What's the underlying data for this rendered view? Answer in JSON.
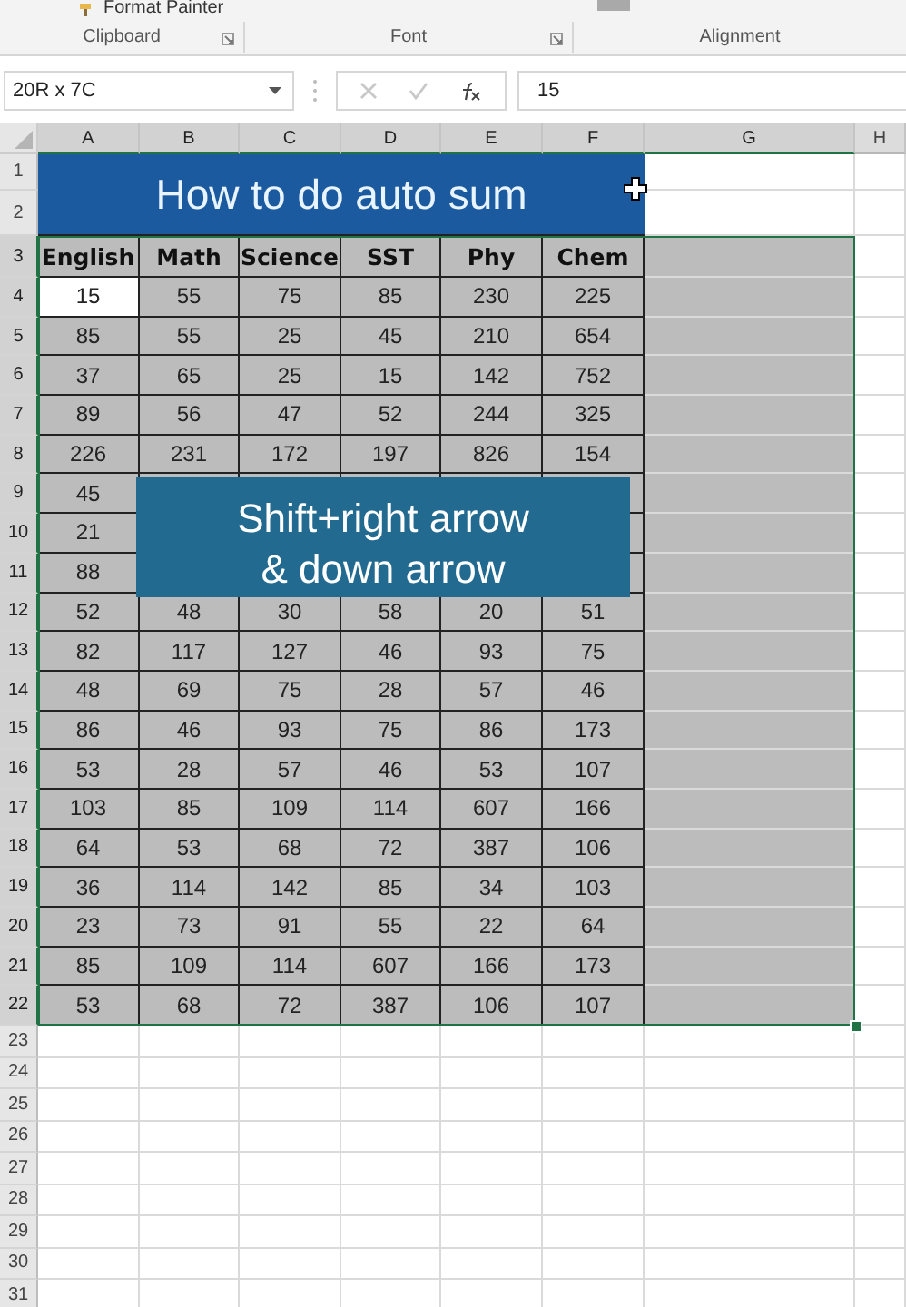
{
  "ribbon": {
    "items": [
      {
        "label": "Format Painter"
      }
    ],
    "groups": [
      {
        "label": "Clipboard",
        "launcher": true
      },
      {
        "label": "Font",
        "launcher": true
      },
      {
        "label": "Alignment",
        "launcher": false
      }
    ]
  },
  "name_box": {
    "value": "20R x 7C"
  },
  "formula_bar": {
    "value": "15"
  },
  "sheet": {
    "columns": [
      {
        "label": "A",
        "selected": true,
        "active": true
      },
      {
        "label": "B",
        "selected": true,
        "active": false
      },
      {
        "label": "C",
        "selected": true,
        "active": false
      },
      {
        "label": "D",
        "selected": true,
        "active": false
      },
      {
        "label": "E",
        "selected": true,
        "active": false
      },
      {
        "label": "F",
        "selected": true,
        "active": false
      },
      {
        "label": "G",
        "selected": true,
        "active": false
      },
      {
        "label": "H",
        "selected": false
      }
    ],
    "title": "How to do auto sum",
    "rows": [
      {
        "number": "1",
        "kind": "title",
        "selected": false
      },
      {
        "number": "2",
        "kind": "title",
        "selected": false
      },
      {
        "number": "3",
        "kind": "header",
        "selected": true,
        "active": false,
        "cells": [
          "English",
          "Math",
          "Science",
          "SST",
          "Phy",
          "Chem"
        ]
      },
      {
        "number": "4",
        "kind": "data",
        "selected": true,
        "active": true,
        "cells": [
          "15",
          "55",
          "75",
          "85",
          "230",
          "225"
        ]
      },
      {
        "number": "5",
        "kind": "data",
        "selected": true,
        "active": false,
        "cells": [
          "85",
          "55",
          "25",
          "45",
          "210",
          "654"
        ]
      },
      {
        "number": "6",
        "kind": "data",
        "selected": true,
        "active": false,
        "cells": [
          "37",
          "65",
          "25",
          "15",
          "142",
          "752"
        ]
      },
      {
        "number": "7",
        "kind": "data",
        "selected": true,
        "active": false,
        "cells": [
          "89",
          "56",
          "47",
          "52",
          "244",
          "325"
        ]
      },
      {
        "number": "8",
        "kind": "data",
        "selected": true,
        "active": false,
        "cells": [
          "226",
          "231",
          "172",
          "197",
          "826",
          "154"
        ]
      },
      {
        "number": "9",
        "kind": "data",
        "selected": true,
        "active": false,
        "cells": [
          "45"
        ]
      },
      {
        "number": "10",
        "kind": "data",
        "selected": true,
        "active": false,
        "cells": [
          "21"
        ]
      },
      {
        "number": "11",
        "kind": "data",
        "selected": true,
        "active": false,
        "cells": [
          "88"
        ]
      },
      {
        "number": "12",
        "kind": "data",
        "selected": true,
        "active": false,
        "cells": [
          "52",
          "48",
          "30",
          "58",
          "20",
          "51"
        ]
      },
      {
        "number": "13",
        "kind": "data",
        "selected": true,
        "active": false,
        "cells": [
          "82",
          "117",
          "127",
          "46",
          "93",
          "75"
        ]
      },
      {
        "number": "14",
        "kind": "data",
        "selected": true,
        "active": false,
        "cells": [
          "48",
          "69",
          "75",
          "28",
          "57",
          "46"
        ]
      },
      {
        "number": "15",
        "kind": "data",
        "selected": true,
        "active": false,
        "cells": [
          "86",
          "46",
          "93",
          "75",
          "86",
          "173"
        ]
      },
      {
        "number": "16",
        "kind": "data",
        "selected": true,
        "active": false,
        "cells": [
          "53",
          "28",
          "57",
          "46",
          "53",
          "107"
        ]
      },
      {
        "number": "17",
        "kind": "data",
        "selected": true,
        "active": false,
        "cells": [
          "103",
          "85",
          "109",
          "114",
          "607",
          "166"
        ]
      },
      {
        "number": "18",
        "kind": "data",
        "selected": true,
        "active": false,
        "cells": [
          "64",
          "53",
          "68",
          "72",
          "387",
          "106"
        ]
      },
      {
        "number": "19",
        "kind": "data",
        "selected": true,
        "active": false,
        "cells": [
          "36",
          "114",
          "142",
          "85",
          "34",
          "103"
        ]
      },
      {
        "number": "20",
        "kind": "data",
        "selected": true,
        "active": false,
        "cells": [
          "23",
          "73",
          "91",
          "55",
          "22",
          "64"
        ]
      },
      {
        "number": "21",
        "kind": "data",
        "selected": true,
        "active": false,
        "cells": [
          "85",
          "109",
          "114",
          "607",
          "166",
          "173"
        ]
      },
      {
        "number": "22",
        "kind": "data",
        "selected": true,
        "active": false,
        "cells": [
          "53",
          "68",
          "72",
          "387",
          "106",
          "107"
        ]
      },
      {
        "number": "23",
        "kind": "empty",
        "selected": false
      },
      {
        "number": "24",
        "kind": "empty",
        "selected": false
      },
      {
        "number": "25",
        "kind": "empty",
        "selected": false
      },
      {
        "number": "26",
        "kind": "empty",
        "selected": false
      },
      {
        "number": "27",
        "kind": "empty",
        "selected": false
      },
      {
        "number": "28",
        "kind": "empty",
        "selected": false
      },
      {
        "number": "29",
        "kind": "empty",
        "selected": false
      },
      {
        "number": "30",
        "kind": "empty",
        "selected": false
      },
      {
        "number": "31",
        "kind": "empty",
        "selected": false
      }
    ]
  },
  "callout": {
    "lines": [
      "Shift+right arrow",
      "& down arrow"
    ]
  }
}
